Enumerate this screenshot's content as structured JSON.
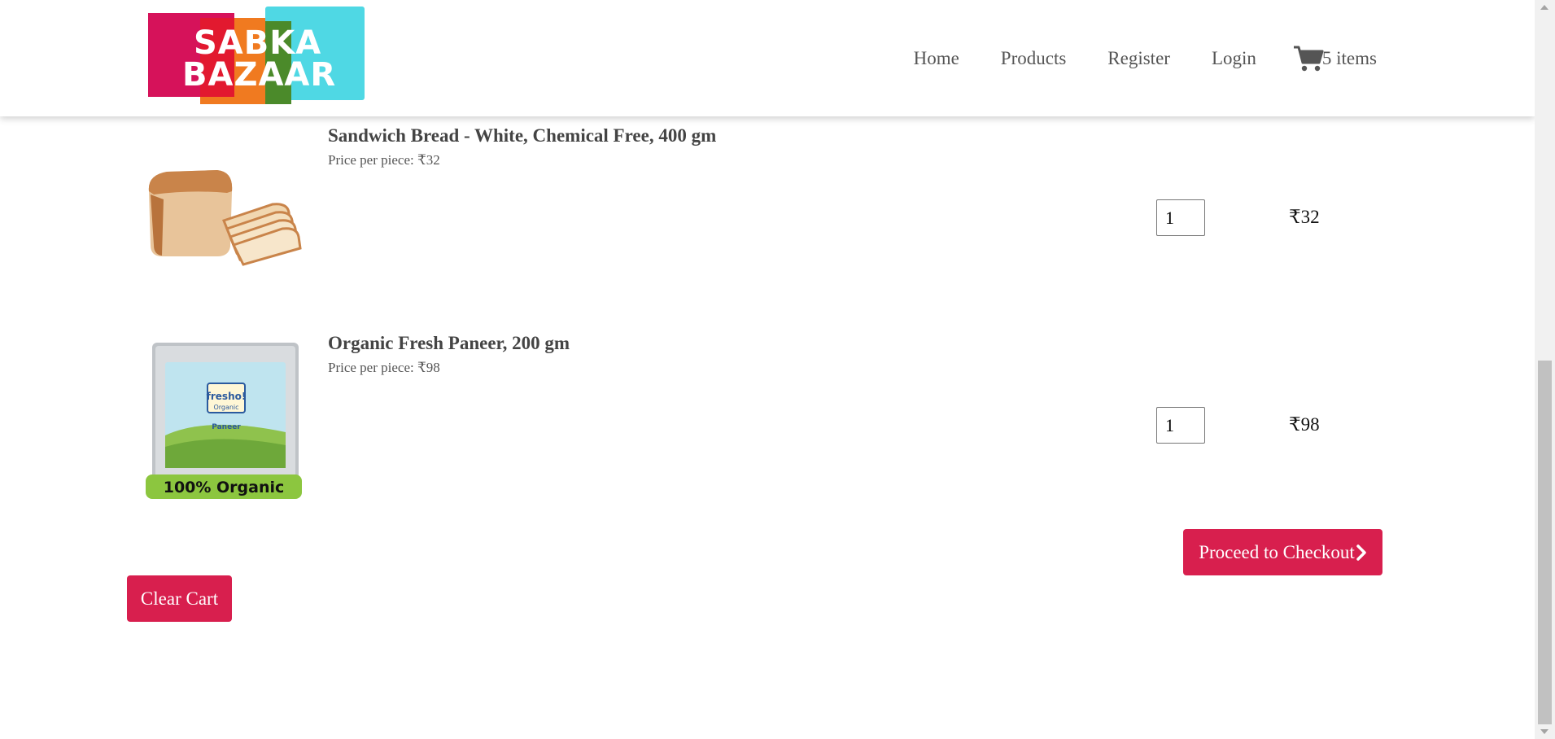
{
  "brand": {
    "logo_line1": "SABKA",
    "logo_line2": "BAZAAR"
  },
  "nav": {
    "home": "Home",
    "products": "Products",
    "register": "Register",
    "login": "Login",
    "cart_count": "5 items",
    "cart_icon": "shopping-cart-icon"
  },
  "cart": {
    "items": [
      {
        "title": "Sandwich Bread - White, Chemical Free, 400 gm",
        "price_text": "Price per piece: ₹32",
        "quantity": "1",
        "total": "₹32",
        "image": "sandwich-bread-image"
      },
      {
        "title": "Organic Fresh Paneer, 200 gm",
        "price_text": "Price per piece: ₹98",
        "quantity": "1",
        "total": "₹98",
        "image": "organic-paneer-image",
        "image_badge": "100% Organic",
        "image_brand": "fresho!",
        "image_sub": "Organic",
        "image_product": "Paneer"
      }
    ],
    "checkout_label": "Proceed to Checkout",
    "clear_label": "Clear Cart"
  },
  "colors": {
    "accent": "#d81f4e",
    "nav_text": "#555555"
  }
}
